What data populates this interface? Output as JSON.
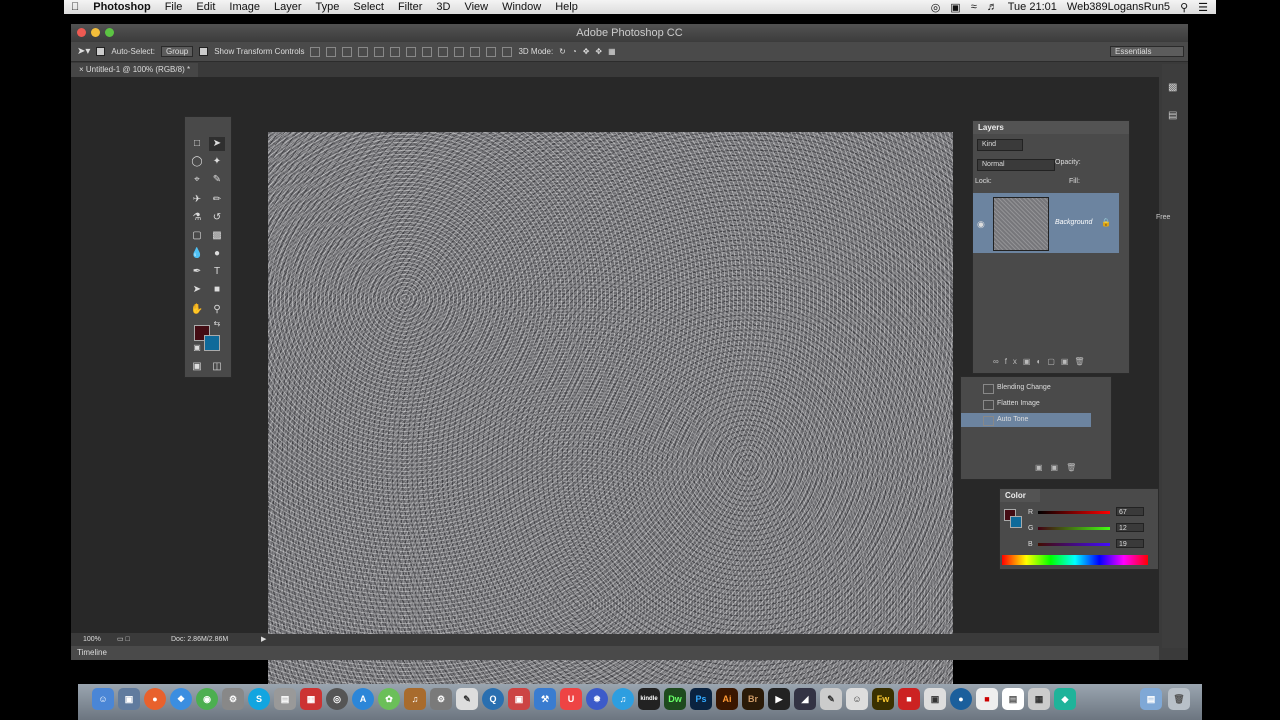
{
  "menubar": {
    "apple": "",
    "app_name": "Photoshop",
    "items": [
      "File",
      "Edit",
      "Image",
      "Layer",
      "Type",
      "Select",
      "Filter",
      "3D",
      "View",
      "Window",
      "Help"
    ],
    "clock": "Tue 21:01",
    "user": "Web389LogansRun5"
  },
  "window": {
    "title": "Adobe Photoshop CC",
    "doc_tab": "Untitled-1 @ 100% (RGB/8) *",
    "workspace": "Essentials",
    "side_note": "Free"
  },
  "options_bar": {
    "auto_select_label": "Auto-Select:",
    "auto_select_value": "Group",
    "show_transform_label": "Show Transform Controls",
    "mode_3d_label": "3D Mode:"
  },
  "status": {
    "zoom": "100%",
    "doc_size": "Doc: 2.86M/2.86M"
  },
  "timeline": {
    "label": "Timeline"
  },
  "layers_panel": {
    "tab": "Layers",
    "kind": "Kind",
    "blend_mode": "Normal",
    "opacity_label": "Opacity:",
    "lock_label": "Lock:",
    "fill_label": "Fill:",
    "layer_name": "Background"
  },
  "history_panel": {
    "items": [
      "Blending Change",
      "Flatten Image",
      "Auto Tone"
    ],
    "selected": "Auto Tone"
  },
  "color_panel": {
    "tab": "Color",
    "r_label": "R",
    "g_label": "G",
    "b_label": "B",
    "r": "67",
    "g": "12",
    "b": "19",
    "foreground": "#430c13",
    "background": "#0f6a9a"
  },
  "dock_labels": {
    "dw": "Dw",
    "ps": "Ps",
    "ai": "Ai",
    "br": "Br",
    "fw": "Fw",
    "kindle": "kindle"
  }
}
